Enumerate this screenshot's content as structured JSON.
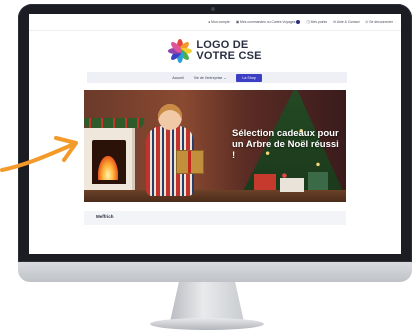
{
  "colors": {
    "accent": "#3c3fc4",
    "arrow": "#f39a2b",
    "frame": "#1b1d22"
  },
  "top_links": [
    {
      "icon": "user-icon",
      "label": "Mon compte"
    },
    {
      "icon": "card-icon",
      "label": "Mes commandes ou Cartes Voyages",
      "badge": true
    },
    {
      "icon": "cart-icon",
      "label": "Mes points"
    },
    {
      "icon": "mail-icon",
      "label": "Aide & Contact"
    },
    {
      "icon": "logout-icon",
      "label": "Se déconnecter"
    }
  ],
  "logo": {
    "line1": "LOGO DE",
    "line2": "VOTRE CSE"
  },
  "nav": {
    "home": "Accueil",
    "entreprise": "Vie de l'entreprise",
    "shop": "La Shop"
  },
  "hero": {
    "title": "Sélection cadeaux pour un Arbre de Noël réussi !"
  },
  "section": {
    "title": "Meffrich"
  }
}
